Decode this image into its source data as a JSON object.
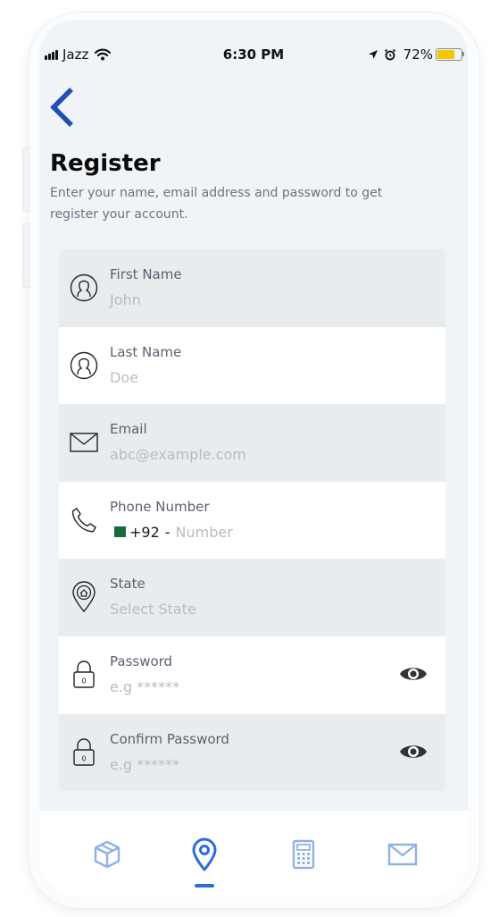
{
  "status_bar": {
    "carrier": "Jazz",
    "time": "6:30 PM",
    "battery_percent": "72%",
    "battery_level": 0.72
  },
  "header": {
    "back_icon": "chevron-left-icon",
    "title": "Register",
    "subtitle": "Enter your name, email address and password to get register your account."
  },
  "form": {
    "first_name": {
      "label": "First Name",
      "placeholder": "John",
      "icon": "user-icon"
    },
    "last_name": {
      "label": "Last Name",
      "placeholder": "Doe",
      "icon": "user-icon"
    },
    "email": {
      "label": "Email",
      "placeholder": "abc@example.com",
      "icon": "envelope-icon"
    },
    "phone": {
      "label": "Phone Number",
      "country_code": "+92",
      "separator": "-",
      "placeholder": "Number",
      "icon": "phone-icon",
      "flag": "pakistan-flag-icon"
    },
    "state": {
      "label": "State",
      "placeholder": "Select State",
      "icon": "location-home-icon"
    },
    "password": {
      "label": "Password",
      "placeholder": "e.g ******",
      "icon": "lock-icon",
      "toggle_icon": "eye-icon"
    },
    "confirm_password": {
      "label": "Confirm Password",
      "placeholder": "e.g ******",
      "icon": "lock-icon",
      "toggle_icon": "eye-icon"
    }
  },
  "bottom_nav": {
    "items": [
      {
        "icon": "box-icon",
        "active": false
      },
      {
        "icon": "location-pin-icon",
        "active": true
      },
      {
        "icon": "calculator-icon",
        "active": false
      },
      {
        "icon": "mail-icon",
        "active": false
      }
    ]
  },
  "colors": {
    "accent": "#2b6fd6",
    "back_arrow": "#1f4fb3",
    "inactive_nav_icon": "#8fb2e3",
    "battery": "#f5c500",
    "shaded_row": "#e8ecef",
    "screen_bg": "#f1f4f7"
  }
}
